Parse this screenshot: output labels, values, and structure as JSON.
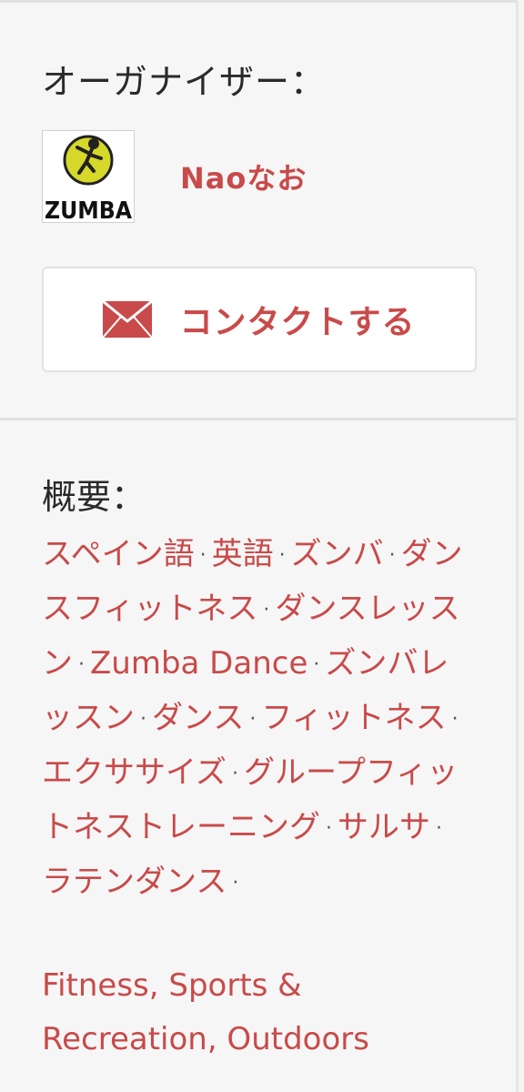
{
  "organizer": {
    "label": "オーガナイザー：",
    "name": "Naoなお",
    "logo_text": "ZUMBA"
  },
  "contact": {
    "label": "コンタクトする",
    "icon": "mail-icon"
  },
  "summary": {
    "label": "概要："
  },
  "topics": [
    "スペイン語",
    "英語",
    "ズンバ",
    "ダンスフィットネス",
    "ダンスレッスン",
    "Zumba Dance",
    "ズンバレッスン",
    "ダンス",
    "フィットネス",
    "エクササイズ",
    "グループフィットネストレーニング",
    "サルサ",
    "ラテンダンス"
  ],
  "category": "Fitness, Sports & Recreation, Outdoors",
  "colors": {
    "accent": "#c94a4a",
    "text": "#2a2a2a",
    "background": "#f6f6f6"
  }
}
